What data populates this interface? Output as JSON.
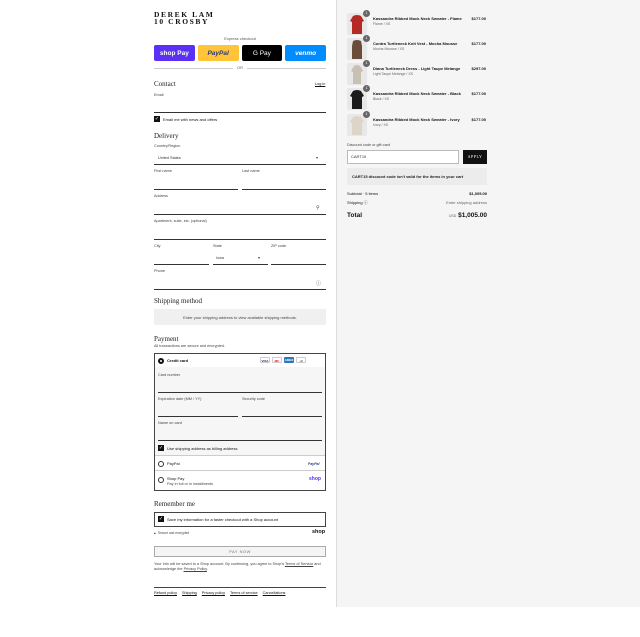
{
  "brand": {
    "line1": "DEREK LAM",
    "line2": "10 CROSBY"
  },
  "express": {
    "label": "Express checkout",
    "shoppay": "shop Pay",
    "paypal": "PayPal",
    "gpay": "G Pay",
    "venmo": "venmo",
    "or": "OR"
  },
  "contact": {
    "heading": "Contact",
    "login": "Log in",
    "email_label": "Email",
    "news_label": "Email me with news and offers"
  },
  "delivery": {
    "heading": "Delivery",
    "country_label": "Country/Region",
    "country_value": "United States",
    "first_name": "First name",
    "last_name": "Last name",
    "address": "Address",
    "apartment": "Apartment, suite, etc. (optional)",
    "city": "City",
    "state_label": "State",
    "state_value": "Iowa",
    "zip": "ZIP code",
    "phone": "Phone"
  },
  "shipping": {
    "heading": "Shipping method",
    "notice": "Enter your shipping address to view available shipping methods."
  },
  "payment": {
    "heading": "Payment",
    "subtitle": "All transactions are secure and encrypted.",
    "credit_card": "Credit card",
    "card_number": "Card number",
    "expiration": "Expiration date (MM / YY)",
    "security": "Security code",
    "name_on_card": "Name on card",
    "billing_same": "Use shipping address as billing address",
    "paypal": "PayPal",
    "shoppay": "Shop Pay",
    "shoppay_sub": "Pay in full or in installments",
    "card_icons": [
      "VISA",
      "MC",
      "AMEX",
      "+6"
    ]
  },
  "remember": {
    "heading": "Remember me",
    "save_label": "Save my information for a faster checkout with a Shop account",
    "secure": "Secure and encrypted",
    "shop": "shop"
  },
  "paynow": "PAY NOW",
  "legal": {
    "text1": "Your info will be saved to a Shop account. By continuing, you agree to Shop's ",
    "terms": "Terms of Service",
    "text2": " and acknowledge the ",
    "privacy": "Privacy Policy",
    "text3": "."
  },
  "footer": [
    "Refund policy",
    "Shipping",
    "Privacy policy",
    "Terms of service",
    "Cancellations"
  ],
  "cart": {
    "items": [
      {
        "qty": "1",
        "name": "Kassandra Ribbed Mock Neck Sweater - Flame",
        "variant": "Flame / XS",
        "price": "$177.00",
        "color": "#b52a24"
      },
      {
        "qty": "1",
        "name": "Contra Turtleneck Knit Vest - Mocha Mousse",
        "variant": "Mocha Mousse / XS",
        "price": "$177.00",
        "color": "#6b4b3a"
      },
      {
        "qty": "1",
        "name": "Diana Turtleneck Dress - Light Taupe Melange",
        "variant": "Light Taupe Melange / XS",
        "price": "$297.00",
        "color": "#c9c0b4"
      },
      {
        "qty": "1",
        "name": "Kassandra Ribbed Mock Neck Sweater - Black",
        "variant": "Black / XS",
        "price": "$177.00",
        "color": "#1c1c1c"
      },
      {
        "qty": "1",
        "name": "Kassandra Ribbed Mock Neck Sweater - Ivory",
        "variant": "Ivory / XS",
        "price": "$177.00",
        "color": "#ddd6c8"
      }
    ],
    "discount_label": "Discount code or gift card",
    "discount_value": "CART15",
    "apply": "APPLY",
    "warning": "CART15 discount code isn't valid for the items in your cart",
    "subtotal_label": "Subtotal · 5 items",
    "subtotal_value": "$1,005.00",
    "shipping_label": "Shipping",
    "shipping_value": "Enter shipping address",
    "total_label": "Total",
    "currency": "USD",
    "total_value": "$1,005.00"
  }
}
